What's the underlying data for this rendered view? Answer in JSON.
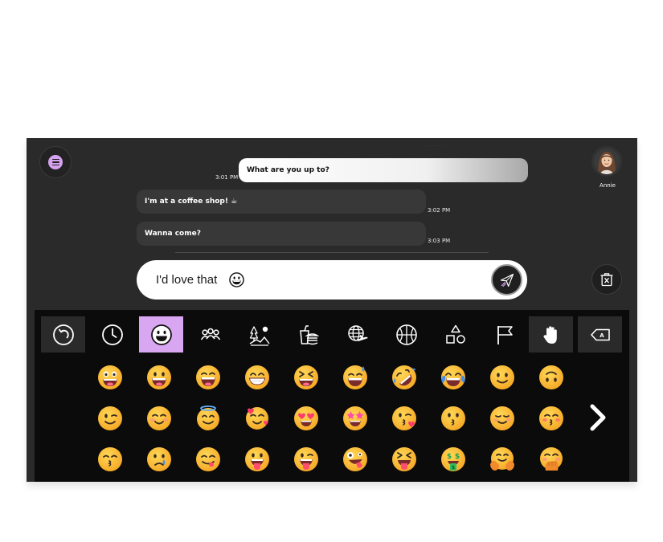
{
  "chat": {
    "messages": [
      {
        "direction": "out",
        "text": "What are you up to?",
        "time": "3:01 PM"
      },
      {
        "direction": "in",
        "text": "I'm at a coffee shop! ☕",
        "time": "3:02 PM"
      },
      {
        "direction": "in",
        "text": "Wanna come?",
        "time": "3:03 PM"
      }
    ]
  },
  "contact": {
    "name": "Annie"
  },
  "composer": {
    "value": "I'd love that",
    "emoji": "grinning-face"
  },
  "keyboard": {
    "categories": [
      {
        "name": "back",
        "icon": "undo-icon",
        "state": "boxed"
      },
      {
        "name": "recent",
        "icon": "clock-icon",
        "state": "normal"
      },
      {
        "name": "smileys",
        "icon": "smiley-icon",
        "state": "active"
      },
      {
        "name": "people",
        "icon": "people-icon",
        "state": "normal"
      },
      {
        "name": "nature",
        "icon": "nature-icon",
        "state": "normal"
      },
      {
        "name": "food",
        "icon": "food-icon",
        "state": "normal"
      },
      {
        "name": "travel",
        "icon": "globe-plane-icon",
        "state": "normal"
      },
      {
        "name": "activities",
        "icon": "basketball-icon",
        "state": "normal"
      },
      {
        "name": "objects",
        "icon": "shapes-icon",
        "state": "normal"
      },
      {
        "name": "flags",
        "icon": "flag-icon",
        "state": "normal"
      },
      {
        "name": "hand-gestures",
        "icon": "hand-icon",
        "state": "boxed"
      },
      {
        "name": "backspace",
        "icon": "backspace-icon",
        "state": "boxed",
        "label": "A"
      }
    ],
    "emoji_rows": [
      [
        "grinning-face-big-eyes",
        "grinning-face",
        "grinning-squinting-face",
        "beaming-face",
        "squinting-tongue-face",
        "sweat-smile-face",
        "rolling-laughing-face",
        "tears-of-joy-face",
        "smiling-face",
        "upside-down-face"
      ],
      [
        "winking-face",
        "blushing-face",
        "halo-face",
        "hearts-face",
        "heart-eyes-face",
        "star-struck-face",
        "kiss-heart-face",
        "kissing-face",
        "relaxed-face",
        "kissing-blush-face"
      ],
      [
        "kissing-smile-face",
        "crying-face",
        "yum-face",
        "tongue-out-face",
        "winking-tongue-face",
        "zany-face",
        "squinting-tongue-out-face",
        "money-mouth-face",
        "hugging-face",
        "hand-over-mouth-face"
      ]
    ]
  },
  "colors": {
    "accent": "#d9a6f2",
    "emoji_yellow": "#fbbf3a",
    "app_bg": "#2a2a2a",
    "keyboard_bg": "#0b0b0b"
  }
}
